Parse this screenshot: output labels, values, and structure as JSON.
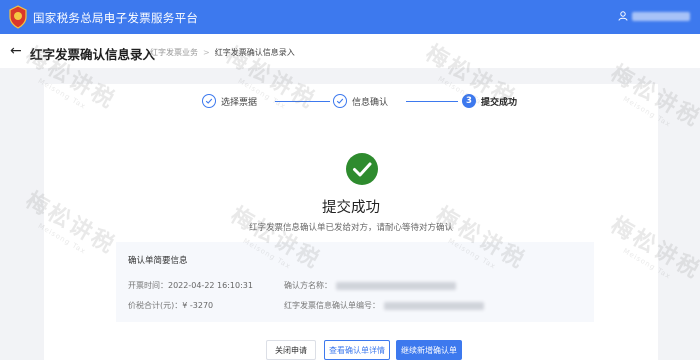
{
  "app": {
    "title": "国家税务总局电子发票服务平台",
    "emblem_icon": "tax-emblem-icon",
    "brand_color": "#3d79ee"
  },
  "header": {
    "title": "红字发票确认信息录入",
    "breadcrumb": [
      "红字发票业务",
      "红字发票确认信息录入"
    ]
  },
  "steps": [
    {
      "number": "1",
      "label": "选择票据",
      "state": "done"
    },
    {
      "number": "2",
      "label": "信息确认",
      "state": "done"
    },
    {
      "number": "3",
      "label": "提交成功",
      "state": "active"
    }
  ],
  "result": {
    "title": "提交成功",
    "description": "红字发票信息确认单已发给对方，请耐心等待对方确认",
    "icon": "check-circle-icon",
    "icon_color": "#2e8b2e"
  },
  "summary": {
    "title": "确认单简要信息",
    "issue_time_label": "开票时间：",
    "issue_time_value": "2022-04-22 16:10:31",
    "confirm_party_label": "确认方名称：",
    "total_label": "价税合计(元)：",
    "total_value": "¥ -3270",
    "confirm_number_label": "红字发票信息确认单编号："
  },
  "buttons": {
    "close": "关闭申请",
    "view_detail": "查看确认单详情",
    "add_new": "继续新增确认单"
  },
  "watermark": {
    "text": "梅松讲税"
  }
}
